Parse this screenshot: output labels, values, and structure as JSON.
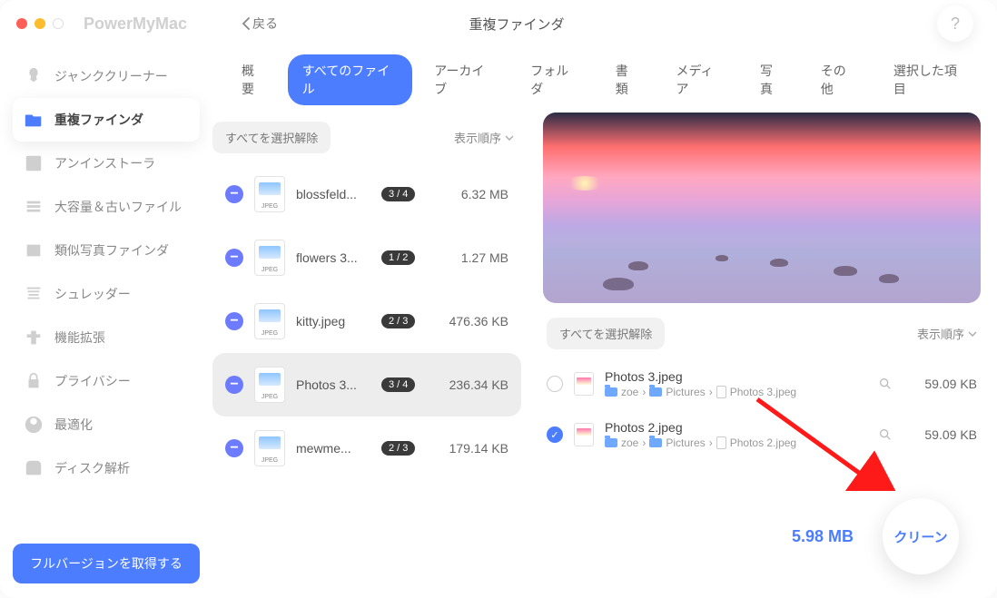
{
  "app_title": "PowerMyMac",
  "back_label": "戻る",
  "window_title": "重複ファインダ",
  "help_label": "?",
  "sidebar": {
    "items": [
      {
        "label": "ジャンククリーナー"
      },
      {
        "label": "重複ファインダ",
        "active": true
      },
      {
        "label": "アンインストーラ"
      },
      {
        "label": "大容量＆古いファイル"
      },
      {
        "label": "類似写真ファインダ"
      },
      {
        "label": "シュレッダー"
      },
      {
        "label": "機能拡張"
      },
      {
        "label": "プライバシー"
      },
      {
        "label": "最適化"
      },
      {
        "label": "ディスク解析"
      }
    ],
    "full_version": "フルバージョンを取得する"
  },
  "tabs": [
    "概要",
    "すべてのファイル",
    "アーカイブ",
    "フォルダ",
    "書類",
    "メディア",
    "写真",
    "その他",
    "選択した項目"
  ],
  "active_tab": 1,
  "left": {
    "deselect_all": "すべてを選択解除",
    "sort_label": "表示順序",
    "files": [
      {
        "name": "blossfeld...",
        "badge": "3 / 4",
        "size": "6.32 MB"
      },
      {
        "name": "flowers 3...",
        "badge": "1 / 2",
        "size": "1.27 MB"
      },
      {
        "name": "kitty.jpeg",
        "badge": "2 / 3",
        "size": "476.36 KB"
      },
      {
        "name": "Photos 3...",
        "badge": "3 / 4",
        "size": "236.34 KB",
        "selected": true
      },
      {
        "name": "mewme...",
        "badge": "2 / 3",
        "size": "179.14 KB"
      }
    ]
  },
  "right": {
    "deselect_all": "すべてを選択解除",
    "sort_label": "表示順序",
    "details": [
      {
        "checked": false,
        "name": "Photos 3.jpeg",
        "path": [
          "zoe",
          "Pictures",
          "Photos 3.jpeg"
        ],
        "size": "59.09 KB"
      },
      {
        "checked": true,
        "name": "Photos 2.jpeg",
        "path": [
          "zoe",
          "Pictures",
          "Photos 2.jpeg"
        ],
        "size": "59.09 KB"
      }
    ]
  },
  "footer": {
    "total": "5.98 MB",
    "clean": "クリーン"
  },
  "thumb_label": "JPEG",
  "chevron": "›"
}
